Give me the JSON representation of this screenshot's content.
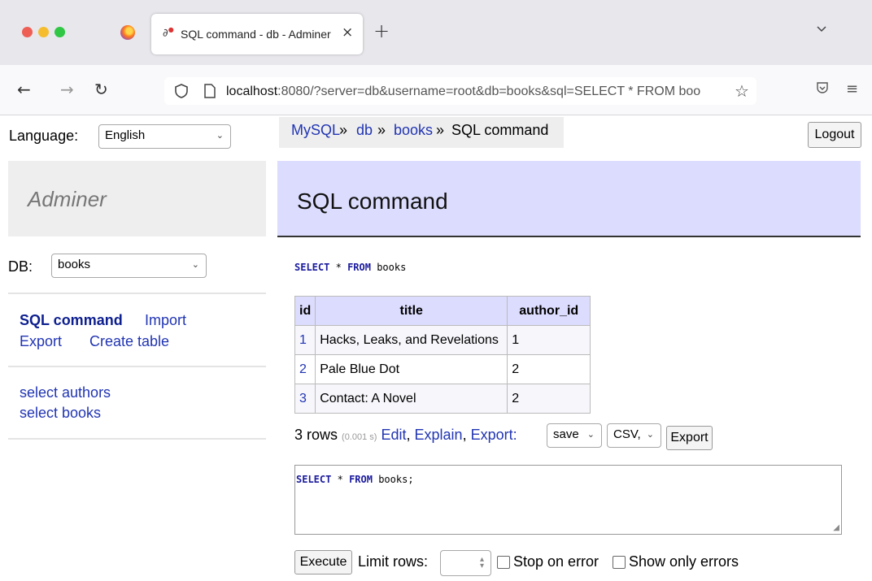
{
  "browser": {
    "tab_title": "SQL command - db - Adminer",
    "tab_close": "×",
    "new_tab": "+",
    "url_host": "localhost",
    "url_rest": ":8080/?server=db&username=root&db=books&sql=SELECT * FROM boo",
    "icons": [
      "back-arrow-icon",
      "forward-arrow-icon",
      "reload-icon",
      "shield-icon",
      "page-icon",
      "star-icon",
      "pocket-icon",
      "menu-icon"
    ]
  },
  "sidebar": {
    "language_label": "Language:",
    "language_value": "English",
    "app_title": "Adminer",
    "db_label": "DB:",
    "db_value": "books",
    "links": {
      "sql_command": "SQL command",
      "import": "Import",
      "export": "Export",
      "create_table": "Create table"
    },
    "tables": [
      "select authors",
      "select books"
    ]
  },
  "breadcrumb": {
    "mysql": "MySQL",
    "sep": "»",
    "db": "db",
    "books": "books",
    "current": "SQL command"
  },
  "header": {
    "logout": "Logout",
    "title": "SQL command"
  },
  "query": {
    "select_kw": "SELECT",
    "star": "*",
    "from_kw": "FROM",
    "table": "books",
    "semicolon": ";"
  },
  "results": {
    "columns": [
      "id",
      "title",
      "author_id"
    ],
    "rows": [
      [
        "1",
        "Hacks, Leaks, and Revelations",
        "1"
      ],
      [
        "2",
        "Pale Blue Dot",
        "2"
      ],
      [
        "3",
        "Contact: A Novel",
        "2"
      ]
    ],
    "rows_count": "3 rows",
    "time": "(0.001 s)",
    "edit": "Edit",
    "explain": "Explain",
    "export": "Export:",
    "save_value": "save",
    "format_value": "CSV,",
    "export_button": "Export"
  },
  "form": {
    "execute": "Execute",
    "limit_label": "Limit rows:",
    "stop_on_error": "Stop on error",
    "show_only_errors": "Show only errors"
  },
  "colors": {
    "link": "#2135b3",
    "header_bg": "#dcdcfe",
    "sidebar_bg": "#eeeeee"
  }
}
